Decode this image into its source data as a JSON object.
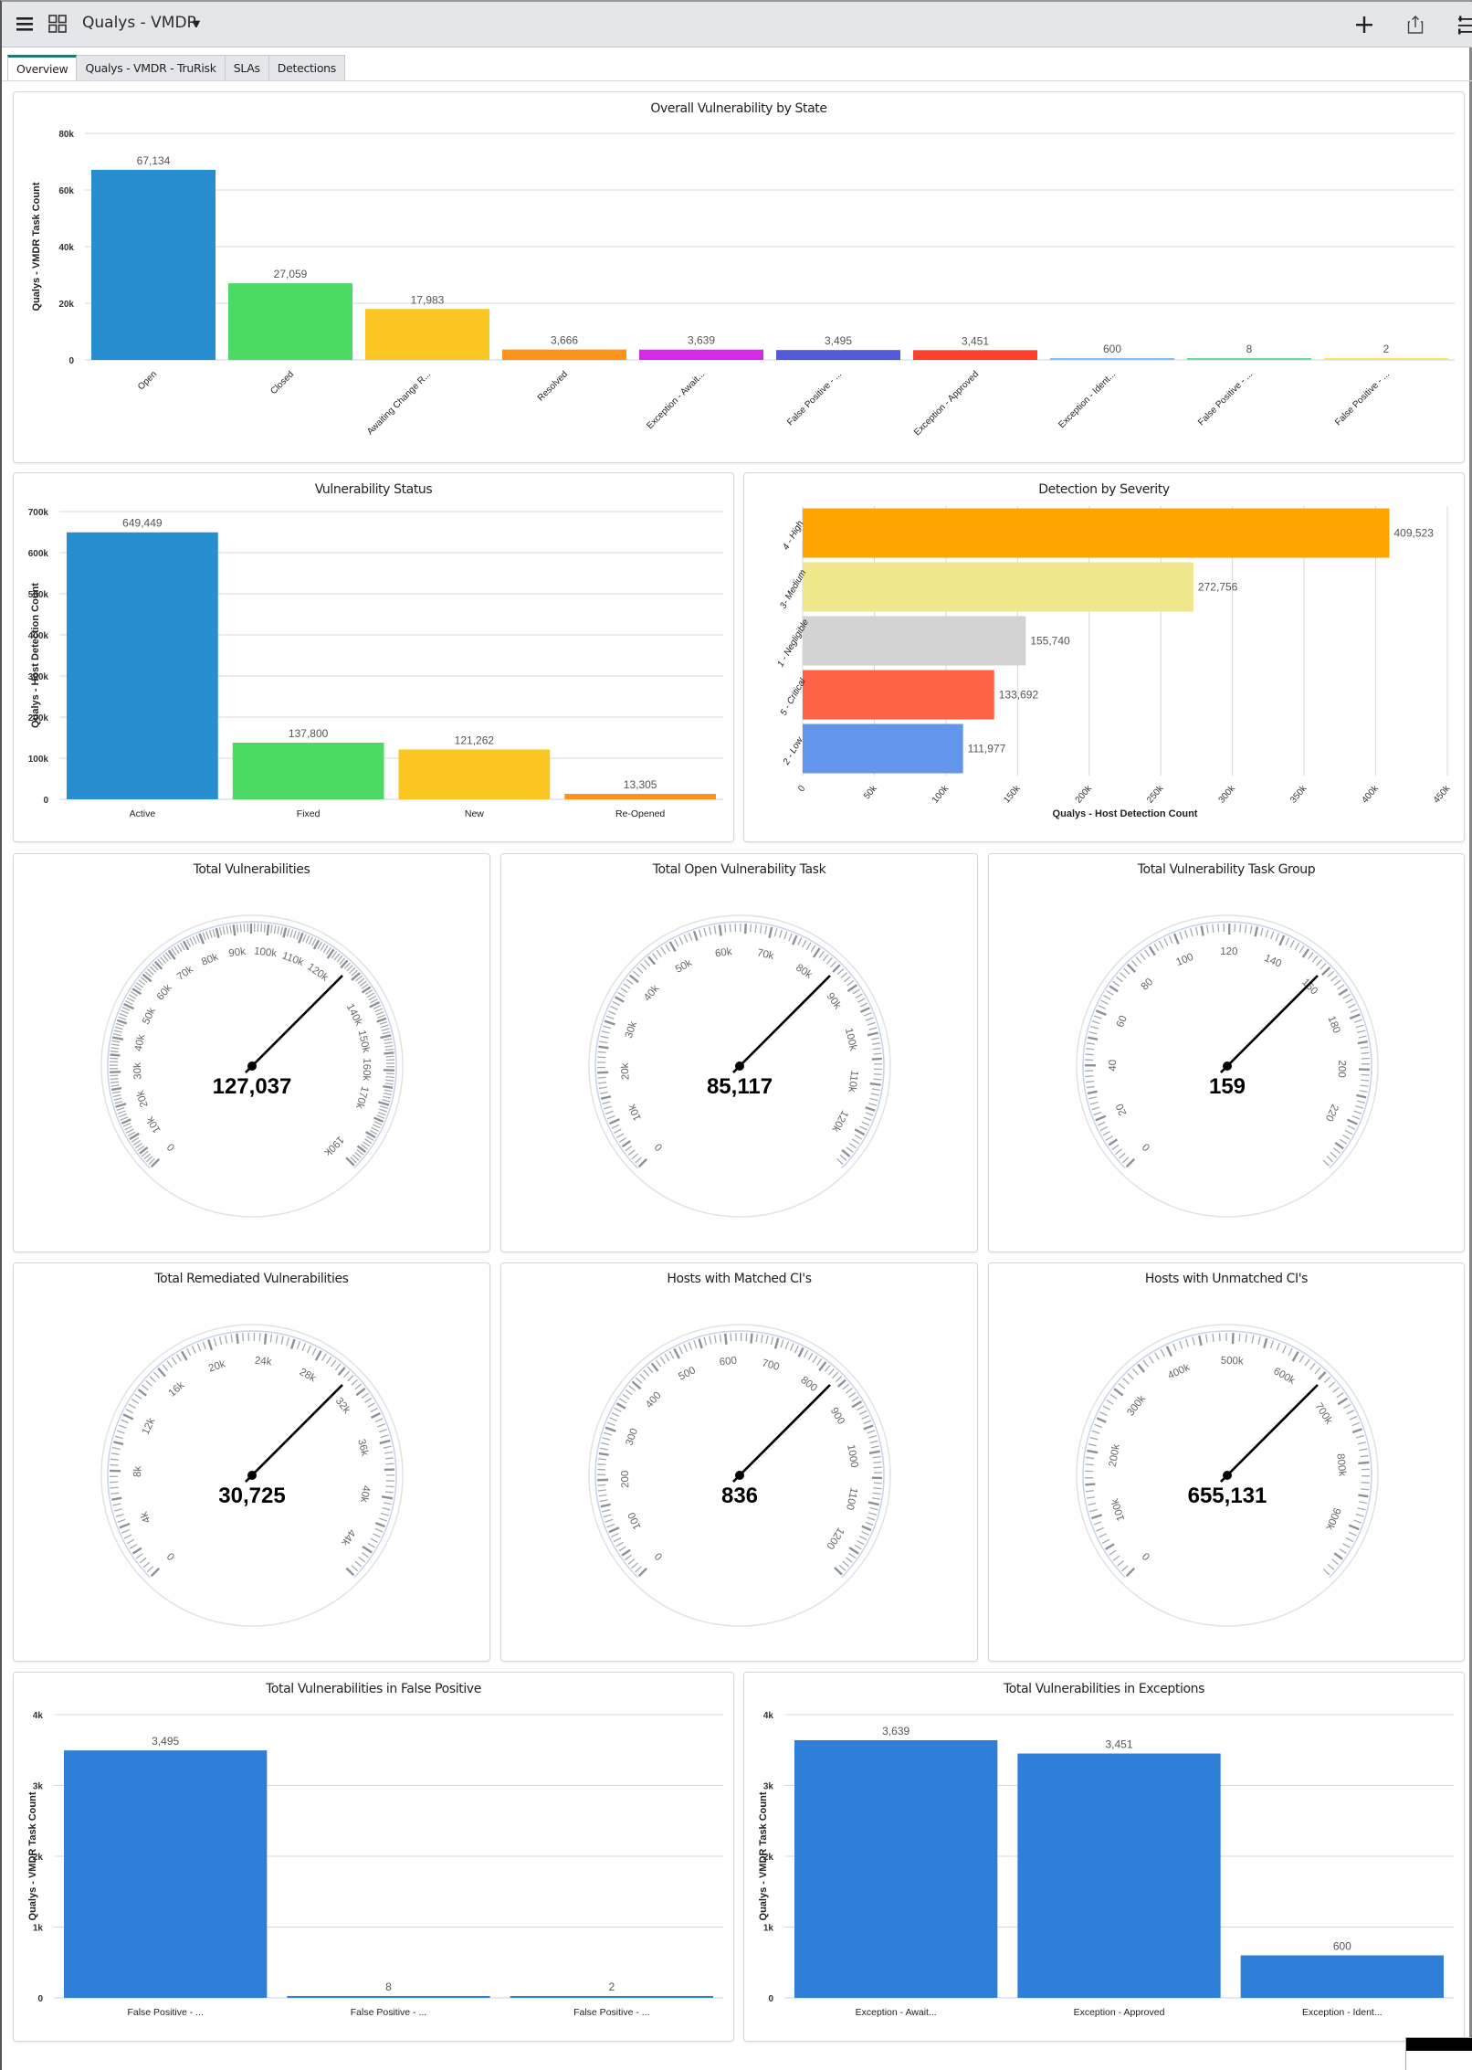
{
  "header": {
    "menu_icon": "hamburger-menu-icon",
    "grid_icon": "dashboard-grid-icon",
    "title": "Qualys - VMDR",
    "title_caret": "▼",
    "add_icon": "plus-icon",
    "share_icon": "share-icon",
    "filter_icon": "sliders-icon"
  },
  "tabs": [
    {
      "label": "Overview",
      "active": true
    },
    {
      "label": "Qualys - VMDR - TruRisk",
      "active": false
    },
    {
      "label": "SLAs",
      "active": false
    },
    {
      "label": "Detections",
      "active": false
    }
  ],
  "colors": {
    "accent": "#1d7a6d",
    "bar_blue": "#2f7ed8"
  },
  "chart_data": [
    {
      "id": "overall",
      "type": "bar",
      "title": "Overall Vulnerability by State",
      "xlabel": "",
      "ylabel": "Qualys - VMDR Task Count",
      "ylim": [
        0,
        80000
      ],
      "yticks": [
        "0",
        "20k",
        "40k",
        "60k",
        "80k"
      ],
      "ytick_values": [
        0,
        20000,
        40000,
        60000,
        80000
      ],
      "grid": true,
      "categories": [
        "Open",
        "Closed",
        "Awaiting Change R...",
        "Resolved",
        "Exception - Await...",
        "False Positive - ...",
        "Exception - Approved",
        "Exception - Ident...",
        "False Positive - ...",
        "False Positive - ..."
      ],
      "values": [
        67134,
        27059,
        17983,
        3666,
        3639,
        3495,
        3451,
        600,
        8,
        2
      ],
      "labels": [
        "67,134",
        "27,059",
        "17,983",
        "3,666",
        "3,639",
        "3,495",
        "3,451",
        "600",
        "8",
        "2"
      ],
      "colors": [
        "#278ecf",
        "#4cd964",
        "#fcc622",
        "#ff9317",
        "#d42ae8",
        "#535ad7",
        "#ff402c",
        "#83bfff",
        "#6edb8f",
        "#ffe366"
      ]
    },
    {
      "id": "status",
      "type": "bar",
      "title": "Vulnerability Status",
      "xlabel": "",
      "ylabel": "Qualys - Host Detection Count",
      "ylim": [
        0,
        700000
      ],
      "yticks": [
        "0",
        "100k",
        "200k",
        "300k",
        "400k",
        "500k",
        "600k",
        "700k"
      ],
      "ytick_values": [
        0,
        100000,
        200000,
        300000,
        400000,
        500000,
        600000,
        700000
      ],
      "grid": true,
      "categories": [
        "Active",
        "Fixed",
        "New",
        "Re-Opened"
      ],
      "values": [
        649449,
        137800,
        121262,
        13305
      ],
      "labels": [
        "649,449",
        "137,800",
        "121,262",
        "13,305"
      ],
      "colors": [
        "#278ecf",
        "#4cd964",
        "#fcc622",
        "#ff9317"
      ]
    },
    {
      "id": "severity",
      "type": "bar",
      "orientation": "horizontal",
      "title": "Detection by Severity",
      "xlabel": "Qualys - Host Detection Count",
      "ylabel": "",
      "xlim": [
        0,
        450000
      ],
      "xticks": [
        "0",
        "50k",
        "100k",
        "150k",
        "200k",
        "250k",
        "300k",
        "350k",
        "400k",
        "450k"
      ],
      "xtick_values": [
        0,
        50000,
        100000,
        150000,
        200000,
        250000,
        300000,
        350000,
        400000,
        450000
      ],
      "grid": true,
      "categories": [
        "4 - High",
        "3- Medium",
        "1 - Negligible",
        "5 - Critical",
        "2 - Low"
      ],
      "values": [
        409523,
        272756,
        155740,
        133692,
        111977
      ],
      "labels": [
        "409,523",
        "272,756",
        "155,740",
        "133,692",
        "111,977"
      ],
      "colors": [
        "#ffa500",
        "#f0e68c",
        "#d3d3d3",
        "#ff6347",
        "#6495ed"
      ]
    },
    {
      "id": "false_positive",
      "type": "bar",
      "title": "Total Vulnerabilities in False Positive",
      "xlabel": "",
      "ylabel": "Qualys - VMDR Task Count",
      "ylim": [
        0,
        4000
      ],
      "yticks": [
        "0",
        "1k",
        "2k",
        "3k",
        "4k"
      ],
      "ytick_values": [
        0,
        1000,
        2000,
        3000,
        4000
      ],
      "grid": true,
      "categories": [
        "False Positive - ...",
        "False Positive - ...",
        "False Positive - ..."
      ],
      "values": [
        3495,
        8,
        2
      ],
      "labels": [
        "3,495",
        "8",
        "2"
      ],
      "colors": [
        "#2f7ed8",
        "#2f7ed8",
        "#2f7ed8"
      ]
    },
    {
      "id": "exceptions",
      "type": "bar",
      "title": "Total Vulnerabilities in Exceptions",
      "xlabel": "",
      "ylabel": "Qualys - VMDR Task Count",
      "ylim": [
        0,
        4000
      ],
      "yticks": [
        "0",
        "1k",
        "2k",
        "3k",
        "4k"
      ],
      "ytick_values": [
        0,
        1000,
        2000,
        3000,
        4000
      ],
      "grid": true,
      "categories": [
        "Exception - Await...",
        "Exception - Approved",
        "Exception - Ident..."
      ],
      "values": [
        3639,
        3451,
        600
      ],
      "labels": [
        "3,639",
        "3,451",
        "600"
      ],
      "colors": [
        "#2f7ed8",
        "#2f7ed8",
        "#2f7ed8"
      ]
    }
  ],
  "gauges": [
    {
      "title": "Total Vulnerabilities",
      "value": 127037,
      "display": "127,037",
      "max": 190555,
      "tick_step": 10000,
      "tick_labels": [
        "0",
        "10k",
        "20k",
        "30k",
        "40k",
        "50k",
        "60k",
        "70k",
        "80k",
        "90k",
        "100k",
        "110k",
        "120k",
        "",
        "140k",
        "150k",
        "160k",
        "170k",
        "",
        "190k"
      ]
    },
    {
      "title": "Total Open Vulnerability Task",
      "value": 85117,
      "display": "85,117",
      "max": 127675,
      "tick_step": 10000,
      "tick_labels": [
        "0",
        "10k",
        "20k",
        "30k",
        "40k",
        "50k",
        "60k",
        "70k",
        "80k",
        "90k",
        "100k",
        "110k",
        "120k"
      ]
    },
    {
      "title": "Total Vulnerability Task Group",
      "value": 159,
      "display": "159",
      "max": 238.5,
      "tick_step": 20,
      "tick_labels": [
        "0",
        "20",
        "40",
        "60",
        "80",
        "100",
        "120",
        "140",
        "160",
        "180",
        "200",
        "220"
      ]
    },
    {
      "title": "Total Remediated Vulnerabilities",
      "value": 30725,
      "display": "30,725",
      "max": 46087,
      "tick_step": 4000,
      "tick_labels": [
        "0",
        "4k",
        "8k",
        "12k",
        "16k",
        "20k",
        "24k",
        "28k",
        "32k",
        "36k",
        "40k",
        "44k"
      ]
    },
    {
      "title": "Hosts with Matched CI's",
      "value": 836,
      "display": "836",
      "max": 1254,
      "tick_step": 100,
      "tick_labels": [
        "0",
        "100",
        "200",
        "300",
        "400",
        "500",
        "600",
        "700",
        "800",
        "900",
        "1000",
        "1100",
        "1200"
      ]
    },
    {
      "title": "Hosts with Unmatched CI's",
      "value": 655131,
      "display": "655,131",
      "max": 982696,
      "tick_step": 100000,
      "tick_labels": [
        "0",
        "100k",
        "200k",
        "300k",
        "400k",
        "500k",
        "600k",
        "700k",
        "800k",
        "900k"
      ]
    }
  ],
  "thumbnail": {
    "icon": "page-thumbnail-preview"
  }
}
